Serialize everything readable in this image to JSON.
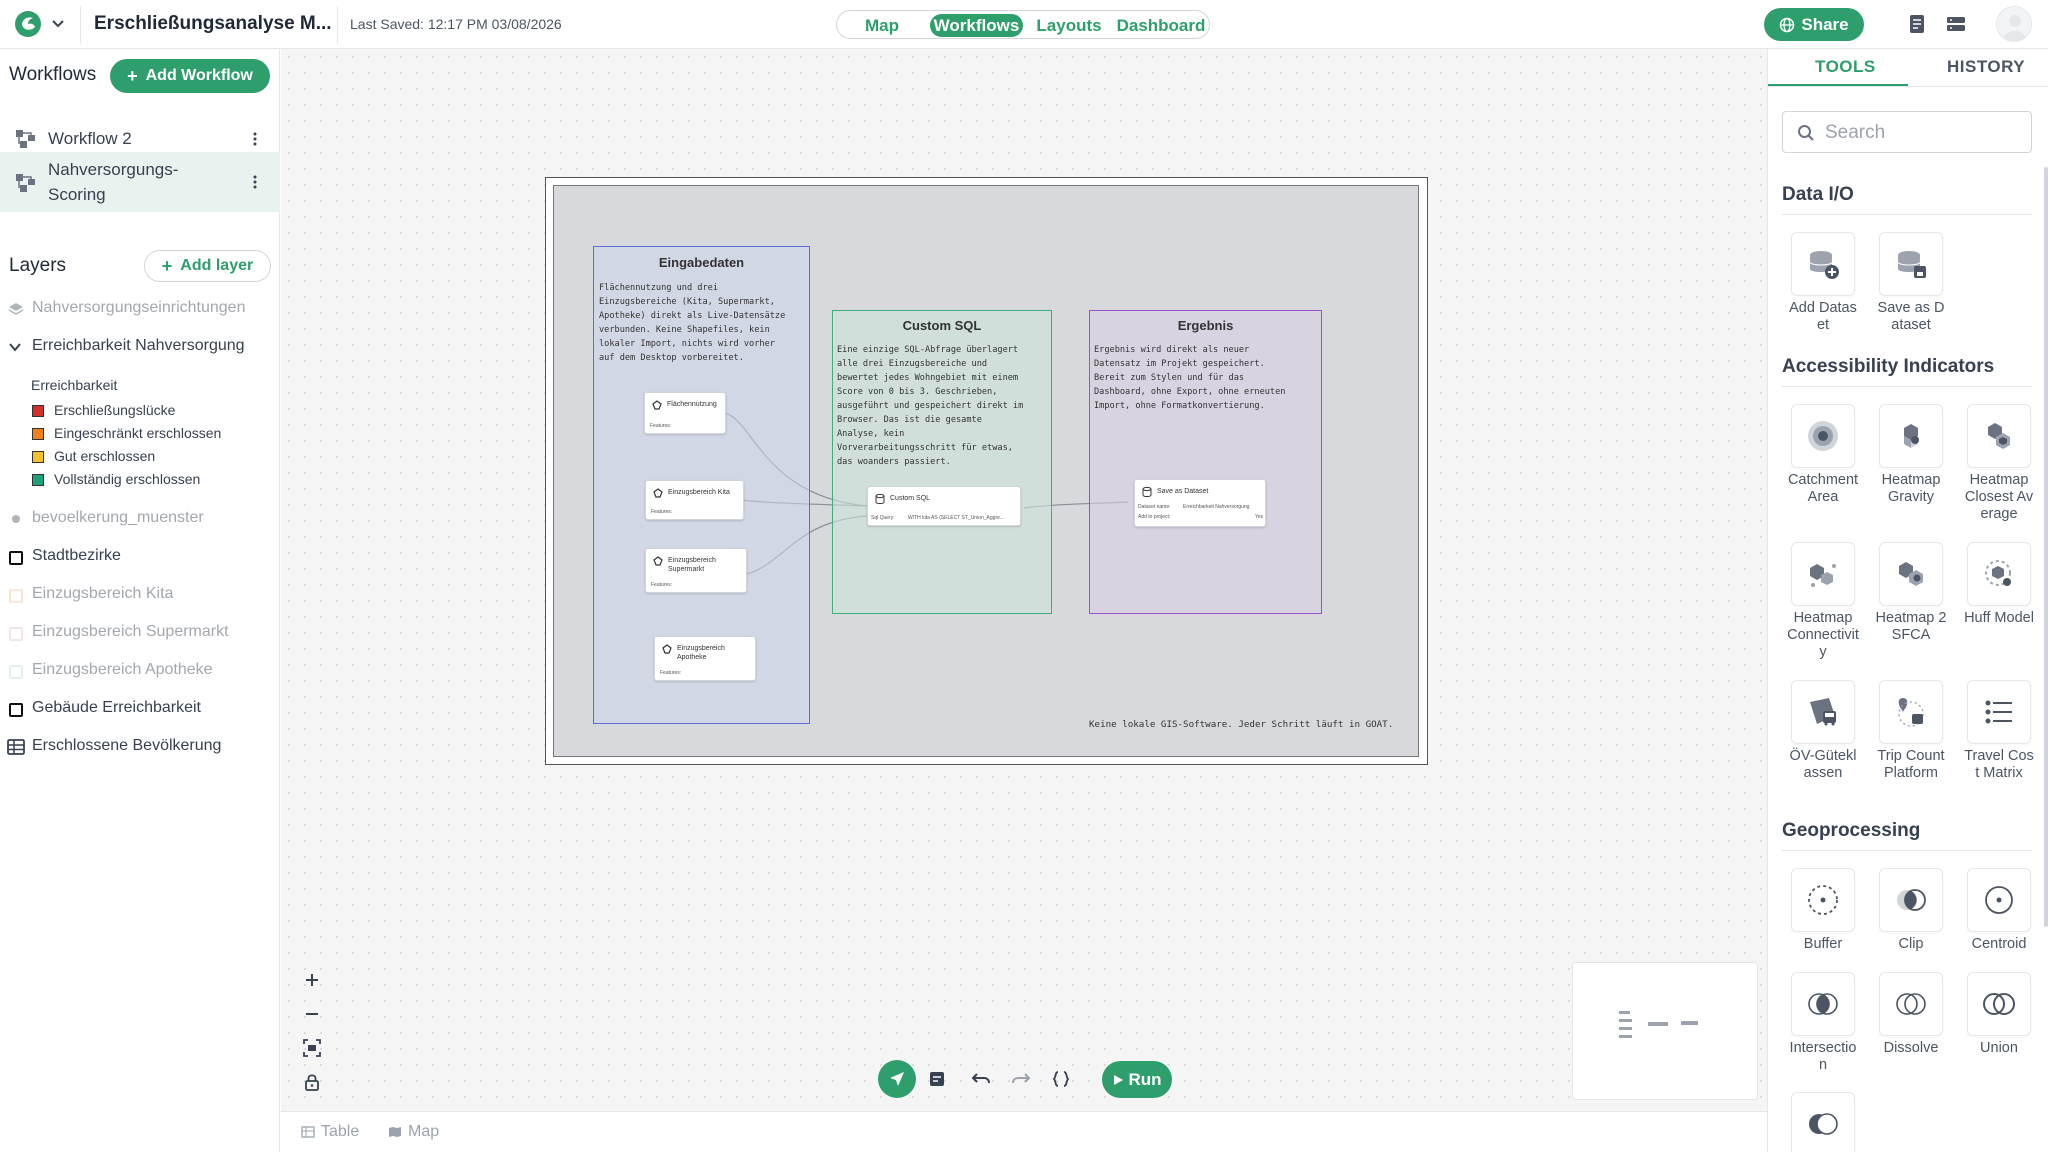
{
  "header": {
    "project_title": "Erschließungsanalyse M...",
    "last_saved": "Last Saved: 12:17 PM 03/08/2026",
    "nav": [
      "Map",
      "Workflows",
      "Layouts",
      "Dashboard"
    ],
    "nav_active": "Workflows",
    "share_label": "Share"
  },
  "workflows": {
    "title": "Workflows",
    "add_label": "Add Workflow",
    "items": [
      {
        "label": "Workflow 2",
        "active": false
      },
      {
        "label": "Nahversorgungs-Scoring",
        "active": true
      }
    ]
  },
  "layers": {
    "title": "Layers",
    "add_label": "Add layer",
    "items": [
      {
        "label": "Nahversorgungseinrichtungen",
        "icon": "stack-icon",
        "muted": true
      },
      {
        "label": "Erreichbarkeit Nahversorgung",
        "icon": "chevron-down-icon",
        "muted": false
      },
      {
        "label": "bevoelkerung_muenster",
        "icon": "point-icon",
        "muted": true
      },
      {
        "label": "Stadtbezirke",
        "icon": "polygon-icon",
        "muted": false
      },
      {
        "label": "Einzugsbereich Kita",
        "icon": "polygon-icon",
        "muted": true
      },
      {
        "label": "Einzugsbereich Supermarkt",
        "icon": "polygon-icon",
        "muted": true
      },
      {
        "label": "Einzugsbereich Apotheke",
        "icon": "polygon-icon",
        "muted": true
      },
      {
        "label": "Gebäude Erreichbarkeit",
        "icon": "polygon-icon",
        "muted": false
      },
      {
        "label": "Erschlossene Bevölkerung",
        "icon": "table-icon",
        "muted": false
      }
    ],
    "legend": {
      "title": "Erreichbarkeit",
      "items": [
        {
          "label": "Erschließungslücke",
          "color": "#d32f2f"
        },
        {
          "label": "Eingeschränkt erschlossen",
          "color": "#f07f1e"
        },
        {
          "label": "Gut erschlossen",
          "color": "#f2c12e"
        },
        {
          "label": "Vollständig erschlossen",
          "color": "#1f9e7a"
        }
      ]
    }
  },
  "canvas": {
    "box_input": {
      "title": "Eingabedaten",
      "desc": "Flächennutzung und drei\nEinzugsbereiche (Kita, Supermarkt,\nApotheke) direkt als Live-Datensätze\nverbunden. Keine Shapefiles, kein\nlokaler Import, nichts wird vorher\nauf dem Desktop vorbereitet."
    },
    "box_sql": {
      "title": "Custom SQL",
      "desc": "Eine einzige SQL-Abfrage überlagert\nalle drei Einzugsbereiche und\nbewertet jedes Wohngebiet mit einem\nScore von 0 bis 3. Geschrieben,\nausgeführt und gespeichert direkt im\nBrowser. Das ist die gesamte\nAnalyse, kein\nVorverarbeitungsschritt für etwas,\ndas woanders passiert."
    },
    "box_result": {
      "title": "Ergebnis",
      "desc": "Ergebnis wird direkt als neuer\nDatensatz im Projekt gespeichert.\nBereit zum Stylen und für das\nDashboard, ohne Export, ohne erneuten\nImport, ohne Formatkonvertierung."
    },
    "nodes": {
      "flaechennutzung": {
        "title": "Flächennutzung",
        "features": "Features:"
      },
      "kita": {
        "title": "Einzugsbereich Kita",
        "features": "Features:"
      },
      "supermarkt": {
        "title": "Einzugsbereich\nSupermarkt",
        "features": "Features:"
      },
      "apotheke": {
        "title": "Einzugsbereich\nApotheke",
        "features": "Features:"
      },
      "sql": {
        "title": "Custom SQL",
        "query_label": "Sql Query:",
        "query": "WITH kita AS (SELECT ST_Union_Aggre..."
      },
      "save": {
        "title": "Save as Dataset",
        "name_label": "Dataset name:",
        "name_value": "Erreichbarkeit Nahversorgung",
        "add_label": "Add to project:",
        "add_value": "Yes"
      }
    },
    "footnote": "Keine lokale GIS-Software. Jeder Schritt läuft in GOAT."
  },
  "bottom": {
    "run_label": "Run",
    "tabs": [
      "Table",
      "Map"
    ]
  },
  "tools": {
    "tabs": [
      "TOOLS",
      "HISTORY"
    ],
    "active_tab": "TOOLS",
    "search_placeholder": "Search",
    "categories": [
      {
        "title": "Data I/O",
        "items": [
          {
            "label": "Add Dataset",
            "icon": "add-dataset-icon"
          },
          {
            "label": "Save as Dataset",
            "icon": "save-dataset-icon"
          }
        ]
      },
      {
        "title": "Accessibility Indicators",
        "items": [
          {
            "label": "Catchment Area",
            "icon": "catchment-area-icon"
          },
          {
            "label": "Heatmap Gravity",
            "icon": "heatmap-gravity-icon"
          },
          {
            "label": "Heatmap Closest Average",
            "icon": "heatmap-closest-average-icon"
          },
          {
            "label": "Heatmap Connectivity",
            "icon": "heatmap-connectivity-icon"
          },
          {
            "label": "Heatmap 2SFCA",
            "icon": "heatmap-2sfca-icon"
          },
          {
            "label": "Huff Model",
            "icon": "huff-model-icon"
          },
          {
            "label": "ÖV-Güteklassen",
            "icon": "oev-gueteklassen-icon"
          },
          {
            "label": "Trip Count Platform",
            "icon": "trip-count-icon"
          },
          {
            "label": "Travel Cost Matrix",
            "icon": "travel-cost-matrix-icon"
          }
        ]
      },
      {
        "title": "Geoprocessing",
        "items": [
          {
            "label": "Buffer",
            "icon": "buffer-icon"
          },
          {
            "label": "Clip",
            "icon": "clip-icon"
          },
          {
            "label": "Centroid",
            "icon": "centroid-icon"
          },
          {
            "label": "Intersection",
            "icon": "intersection-icon"
          },
          {
            "label": "Dissolve",
            "icon": "dissolve-icon"
          },
          {
            "label": "Union",
            "icon": "union-icon"
          },
          {
            "label": "",
            "icon": "difference-icon"
          }
        ]
      }
    ]
  }
}
